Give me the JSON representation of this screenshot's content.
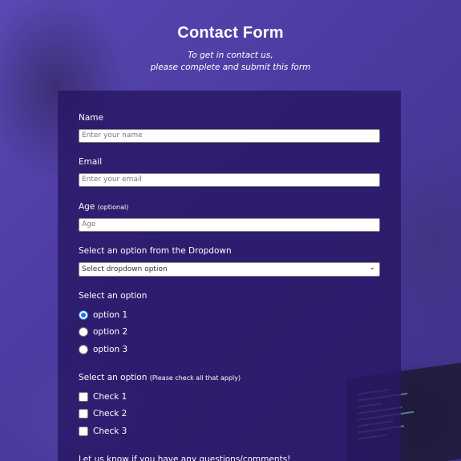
{
  "header": {
    "title": "Contact Form",
    "subtitle_line1": "To get in contact us,",
    "subtitle_line2": "please complete and submit this form"
  },
  "form": {
    "name": {
      "label": "Name",
      "placeholder": "Enter your name"
    },
    "email": {
      "label": "Email",
      "placeholder": "Enter your email"
    },
    "age": {
      "label": "Age",
      "note": "(optional)",
      "placeholder": "Age"
    },
    "dropdown": {
      "label": "Select an option from the Dropdown",
      "selected": "Select dropdown option"
    },
    "radio_group": {
      "label": "Select an option",
      "options": [
        "option 1",
        "option 2",
        "option 3"
      ],
      "selected_index": 0
    },
    "checkbox_group": {
      "label": "Select an option",
      "note": "(Please check all that apply)",
      "options": [
        "Check 1",
        "Check 2",
        "Check 3"
      ]
    },
    "comments_label_partial": "Let us know if you have any questions/comments!"
  },
  "colors": {
    "card_bg": "#28166a",
    "radio_accent": "#1a73e8",
    "background_tint": "#4d3ca2"
  }
}
